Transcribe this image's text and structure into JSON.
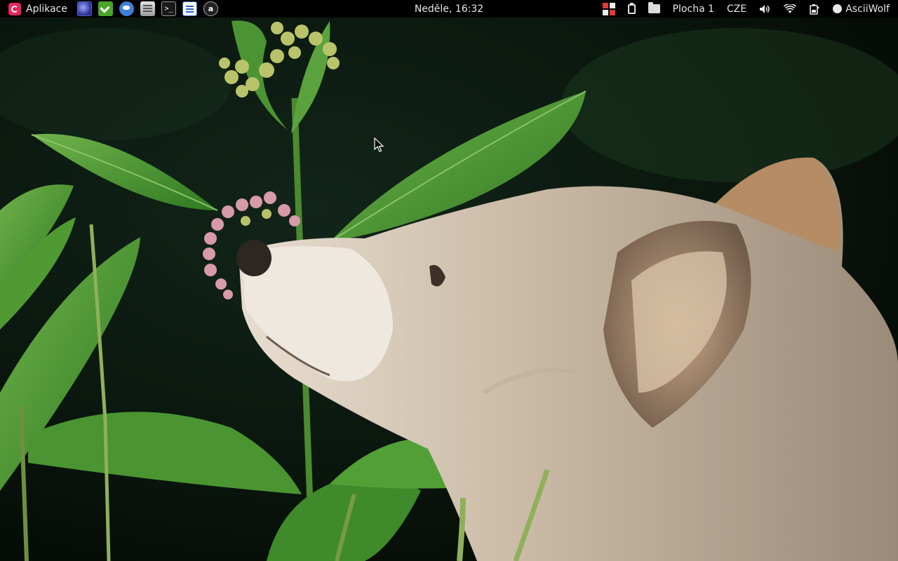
{
  "panel": {
    "apps_label": "Aplikace",
    "launchers": [
      {
        "name": "browser-launcher",
        "icon": "globe-icon"
      },
      {
        "name": "software-center-launcher",
        "icon": "checkmark-bag-icon"
      },
      {
        "name": "chat-launcher",
        "icon": "chat-bubble-icon"
      },
      {
        "name": "file-manager-launcher",
        "icon": "cabinet-icon"
      },
      {
        "name": "terminal-launcher",
        "icon": "terminal-icon",
        "glyph": ">_"
      },
      {
        "name": "writer-launcher",
        "icon": "document-icon"
      },
      {
        "name": "amule-launcher",
        "icon": "amule-icon",
        "glyph": "a"
      }
    ],
    "clock": "Neděle, 16:32",
    "workspace": "Plocha 1",
    "keyboard_layout": "CZE",
    "user_name": "AsciiWolf"
  },
  "wallpaper": {
    "subject": "wolf-sniffing-milkweed-flower"
  },
  "colors": {
    "panel_bg": "#000000",
    "apps_icon": "#e8245e",
    "leaf_green": "#3f8f2a",
    "background_dark": "#0c1a0c"
  }
}
